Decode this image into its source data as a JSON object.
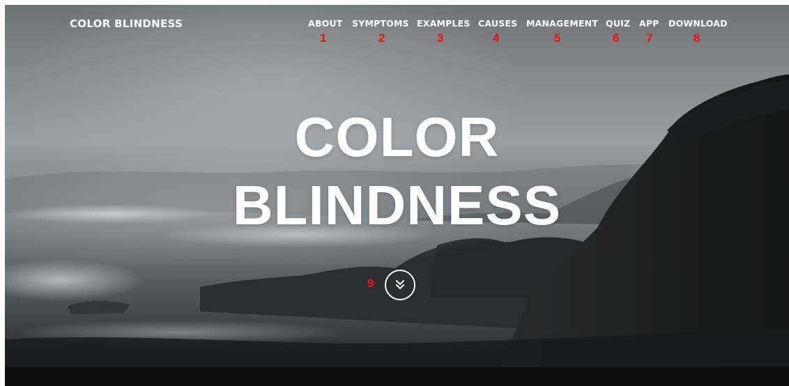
{
  "brand": "COLOR BLINDNESS",
  "nav": {
    "items": [
      {
        "label": "ABOUT",
        "marker": "1"
      },
      {
        "label": "SYMPTOMS",
        "marker": "2"
      },
      {
        "label": "EXAMPLES",
        "marker": "3"
      },
      {
        "label": "CAUSES",
        "marker": "4"
      },
      {
        "label": "MANAGEMENT",
        "marker": "5"
      },
      {
        "label": "QUIZ",
        "marker": "6"
      },
      {
        "label": "APP",
        "marker": "7"
      },
      {
        "label": "DOWNLOAD",
        "marker": "8"
      }
    ]
  },
  "hero": {
    "title_line1": "COLOR",
    "title_line2": "BLINDNESS",
    "scroll_marker": "9",
    "scroll_icon": "double-chevron-down-icon"
  },
  "colors": {
    "text": "#ffffff",
    "marker": "#ee1111"
  }
}
